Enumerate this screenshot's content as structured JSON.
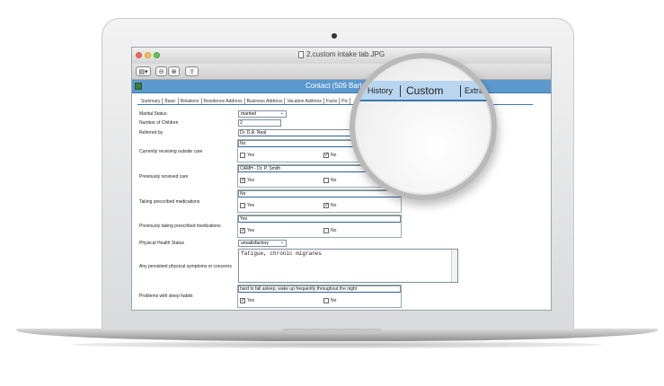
{
  "window": {
    "title": "2.custom intake tab.JPG"
  },
  "record": {
    "title": "Contact (509   Barto"
  },
  "tabs": [
    "Summary",
    "Basic",
    "Relations",
    "Residence Address",
    "Business Address",
    "Vacation Address",
    "Facts",
    "Pic"
  ],
  "fields": {
    "marital_status_label": "Marital Status",
    "marital_status_value": "married",
    "children_label": "Number of Children",
    "children_value": "2",
    "referred_label": "Referred by",
    "referred_value": "Dr. D.A. Neal",
    "outside_care_label": "Currently receiving outside care",
    "outside_care_value": "No",
    "prev_care_label": "Previously received care",
    "prev_care_value": "CAMH - Dr. P. Smith",
    "taking_meds_label": "Taking prescribed medications",
    "taking_meds_value": "No",
    "prev_meds_label": "Previously taking prescribed medications",
    "prev_meds_value": "Yes",
    "health_label": "Physical Health Status",
    "health_value": "unsatisfactory",
    "symptoms_label": "Any persistent physical symptoms or concerns",
    "symptoms_value": "fatigue, chronic migranes",
    "sleep_label": "Problems with sleep habits",
    "sleep_value": "hard to fall asleep, wake up frequently throughout the night"
  },
  "checkbox": {
    "yes": "Yes",
    "no": "No"
  },
  "magnifier": {
    "tab_left": "History",
    "tab_active": "Custom",
    "tab_right": "Extra"
  }
}
